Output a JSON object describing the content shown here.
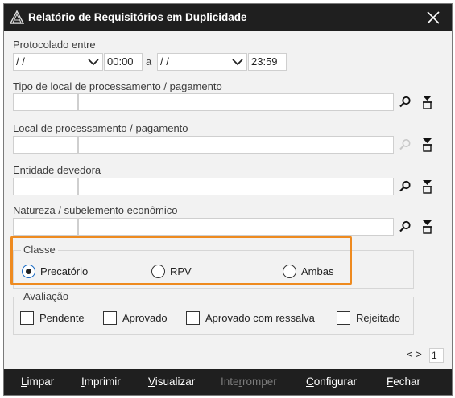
{
  "window": {
    "title": "Relatório de Requisitórios em Duplicidade"
  },
  "protocolado": {
    "label": "Protocolado entre",
    "date_from": "/ /",
    "time_from": "00:00",
    "separator": "a",
    "date_to": "/ /",
    "time_to": "23:59"
  },
  "tipo_local": {
    "label": "Tipo de local de processamento / pagamento",
    "code": "",
    "description": ""
  },
  "local": {
    "label": "Local de processamento / pagamento",
    "code": "",
    "description": ""
  },
  "entidade": {
    "label": "Entidade devedora",
    "code": "",
    "description": ""
  },
  "natureza": {
    "label": "Natureza / subelemento econômico",
    "code": "",
    "description": ""
  },
  "classe": {
    "title": "Classe",
    "options": [
      "Precatório",
      "RPV",
      "Ambas"
    ],
    "selected": "Precatório"
  },
  "avaliacao": {
    "title": "Avaliação",
    "options": [
      "Pendente",
      "Aprovado",
      "Aprovado com ressalva",
      "Rejeitado"
    ]
  },
  "pager": {
    "arrows": "< >",
    "page": "1"
  },
  "footer": {
    "limpar": {
      "u": "L",
      "rest": "impar"
    },
    "imprimir": {
      "u": "I",
      "rest": "mprimir"
    },
    "visualizar": {
      "u": "V",
      "rest": "isualizar"
    },
    "interromper": {
      "pre": "Inte",
      "u": "r",
      "rest": "romper"
    },
    "configurar": {
      "u": "C",
      "rest": "onfigurar"
    },
    "fechar": {
      "u": "F",
      "rest": "echar"
    }
  },
  "colors": {
    "highlight": "#ee8a1f",
    "titlebar": "#1f1f1f",
    "radio_selected": "#1a6bc4"
  }
}
